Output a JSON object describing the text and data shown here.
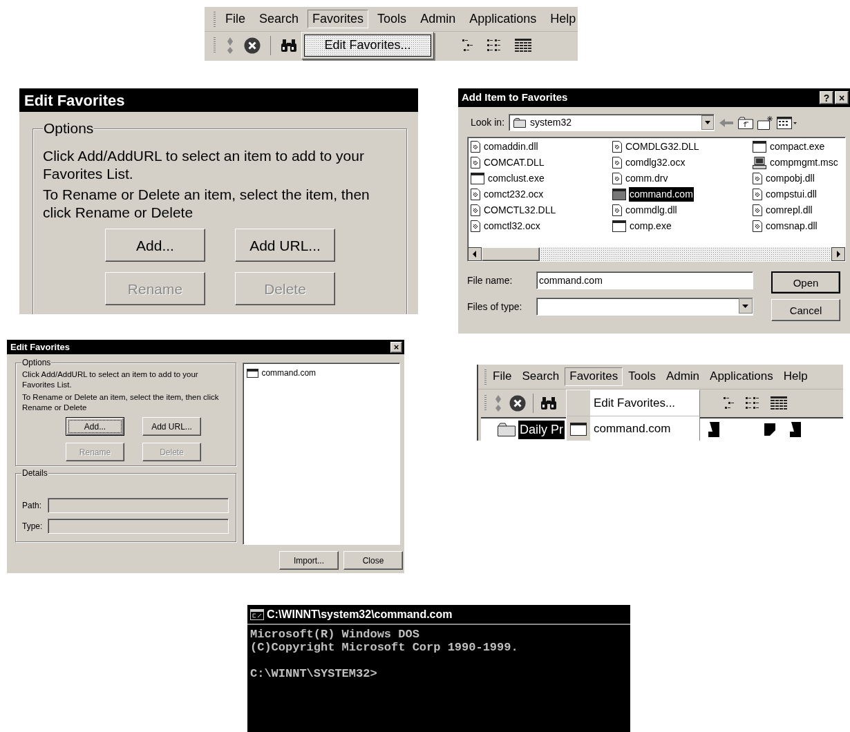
{
  "toolbar_top": {
    "menu": [
      {
        "label": "File",
        "selected": false
      },
      {
        "label": "Search",
        "selected": false
      },
      {
        "label": "Favorites",
        "selected": true
      },
      {
        "label": "Tools",
        "selected": false
      },
      {
        "label": "Admin",
        "selected": false
      },
      {
        "label": "Applications",
        "selected": false
      },
      {
        "label": "Help",
        "selected": false
      }
    ],
    "dropdown": [
      {
        "label": "Edit Favorites...",
        "selected": true
      }
    ]
  },
  "edit_favorites_zoomed": {
    "title": "Edit Favorites",
    "group": "Options",
    "texts": [
      "Click Add/AddURL to select an item to add to your Favorites List.",
      "To Rename or Delete an item, select the item, then click Rename or Delete"
    ],
    "buttons": [
      {
        "label": "Add...",
        "disabled": false,
        "focused": false
      },
      {
        "label": "Add URL...",
        "disabled": false,
        "focused": false
      },
      {
        "label": "Rename",
        "disabled": true,
        "focused": false
      },
      {
        "label": "Delete",
        "disabled": true,
        "focused": false
      }
    ]
  },
  "add_item_dialog": {
    "title": "Add Item to Favorites",
    "title_buttons": [
      "?",
      "×"
    ],
    "look_in_label": "Look in:",
    "look_in_value": "system32",
    "files": [
      {
        "name": "comaddin.dll",
        "kind": "library",
        "selected": false
      },
      {
        "name": "COMCAT.DLL",
        "kind": "library",
        "selected": false
      },
      {
        "name": "comclust.exe",
        "kind": "program",
        "selected": false
      },
      {
        "name": "comct232.ocx",
        "kind": "library",
        "selected": false
      },
      {
        "name": "COMCTL32.DLL",
        "kind": "library",
        "selected": false
      },
      {
        "name": "comctl32.ocx",
        "kind": "library",
        "selected": false
      },
      {
        "name": "COMDLG32.DLL",
        "kind": "library",
        "selected": false
      },
      {
        "name": "comdlg32.ocx",
        "kind": "library",
        "selected": false
      },
      {
        "name": "comm.drv",
        "kind": "library",
        "selected": false
      },
      {
        "name": "command.com",
        "kind": "dos",
        "selected": true
      },
      {
        "name": "commdlg.dll",
        "kind": "library",
        "selected": false
      },
      {
        "name": "comp.exe",
        "kind": "program",
        "selected": false
      },
      {
        "name": "compact.exe",
        "kind": "program",
        "selected": false
      },
      {
        "name": "compmgmt.msc",
        "kind": "console",
        "selected": false
      },
      {
        "name": "compobj.dll",
        "kind": "library",
        "selected": false
      },
      {
        "name": "compstui.dll",
        "kind": "library",
        "selected": false
      },
      {
        "name": "comrepl.dll",
        "kind": "library",
        "selected": false
      },
      {
        "name": "comsnap.dll",
        "kind": "library",
        "selected": false
      }
    ],
    "file_name_label": "File name:",
    "file_name_value": "command.com",
    "file_type_label": "Files of type:",
    "buttons": [
      {
        "label": "Open",
        "default": true
      },
      {
        "label": "Cancel",
        "default": false
      }
    ]
  },
  "edit_favorites_dialog": {
    "title": "Edit Favorites",
    "close": "×",
    "options_group": "Options",
    "texts": [
      "Click Add/AddURL to select an item to add to your Favorites List.",
      "To Rename or Delete an item, select the item, then click Rename or Delete"
    ],
    "buttons": [
      {
        "label": "Add...",
        "disabled": false,
        "focused": true
      },
      {
        "label": "Add URL...",
        "disabled": false,
        "focused": false
      },
      {
        "label": "Rename",
        "disabled": true,
        "focused": false
      },
      {
        "label": "Delete",
        "disabled": true,
        "focused": false
      }
    ],
    "details_group": "Details",
    "fields": [
      {
        "label": "Path:"
      },
      {
        "label": "Type:"
      }
    ],
    "favorites": [
      {
        "name": "command.com",
        "selected": false
      }
    ],
    "footer_buttons": [
      "Import...",
      "Close"
    ]
  },
  "toolbar_bottom": {
    "menu": [
      {
        "label": "File",
        "selected": false
      },
      {
        "label": "Search",
        "selected": false
      },
      {
        "label": "Favorites",
        "selected": true
      },
      {
        "label": "Tools",
        "selected": false
      },
      {
        "label": "Admin",
        "selected": false
      },
      {
        "label": "Applications",
        "selected": false
      },
      {
        "label": "Help",
        "selected": false
      }
    ],
    "dropdown": [
      {
        "label": "Edit Favorites...",
        "kind": "command",
        "selected": false
      },
      {
        "label": "command.com",
        "kind": "favorite",
        "selected": false
      }
    ],
    "tree_item": {
      "label": "Daily Pr",
      "selected": true
    }
  },
  "console": {
    "title": "C:\\WINNT\\system32\\command.com",
    "lines": [
      "Microsoft(R) Windows DOS",
      "(C)Copyright Microsoft Corp 1990-1999."
    ],
    "prompt": "C:\\WINNT\\SYSTEM32>"
  }
}
